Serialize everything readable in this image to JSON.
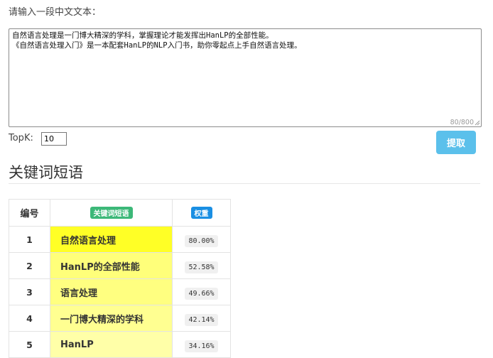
{
  "prompt_label": "请输入一段中文文本：",
  "input_text": "自然语言处理是一门博大精深的学科，掌握理论才能发挥出HanLP的全部性能。\n《自然语言处理入门》是一本配套HanLP的NLP入门书，助你零起点上手自然语言处理。",
  "char_counter": "80/800",
  "topk_label": "TopK:",
  "topk_value": "10",
  "extract_button": "提取",
  "section_title": "关键词短语",
  "table": {
    "headers": {
      "no": "编号",
      "keyword": "关键词短语",
      "weight": "权重"
    },
    "rows": [
      {
        "no": "1",
        "keyword": "自然语言处理",
        "weight": "80.00%",
        "highlight": "#ffff26"
      },
      {
        "no": "2",
        "keyword": "HanLP的全部性能",
        "weight": "52.58%",
        "highlight": "#ffff7a"
      },
      {
        "no": "3",
        "keyword": "语言处理",
        "weight": "49.66%",
        "highlight": "#ffff80"
      },
      {
        "no": "4",
        "keyword": "一门博大精深的学科",
        "weight": "42.14%",
        "highlight": "#ffff91"
      },
      {
        "no": "5",
        "keyword": "HanLP",
        "weight": "34.16%",
        "highlight": "#ffffa8"
      }
    ]
  },
  "colors": {
    "button": "#5bc0eb",
    "badge_keyword": "#3cb878",
    "badge_weight": "#1a8fe3"
  }
}
